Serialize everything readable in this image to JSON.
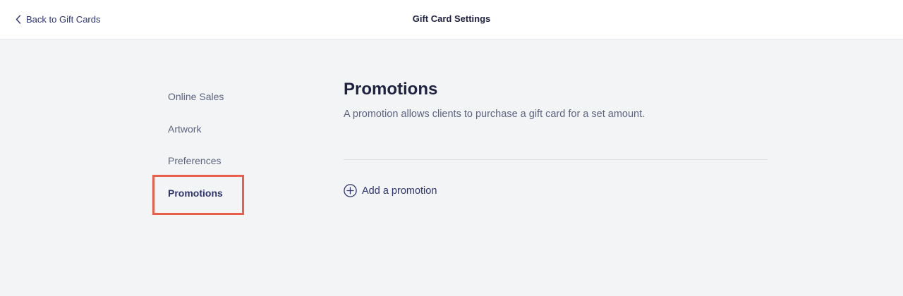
{
  "header": {
    "back_label": "Back to Gift Cards",
    "title": "Gift Card Settings"
  },
  "sidebar": {
    "items": [
      {
        "label": "Online Sales",
        "active": false
      },
      {
        "label": "Artwork",
        "active": false
      },
      {
        "label": "Preferences",
        "active": false
      },
      {
        "label": "Promotions",
        "active": true
      }
    ]
  },
  "main": {
    "title": "Promotions",
    "description": "A promotion allows clients to purchase a gift card for a set amount.",
    "add_label": "Add a promotion"
  },
  "icons": {
    "back": "chevron-left-icon",
    "add": "plus-circle-icon"
  },
  "colors": {
    "accent": "#2e3470",
    "highlight": "#e8604c"
  }
}
